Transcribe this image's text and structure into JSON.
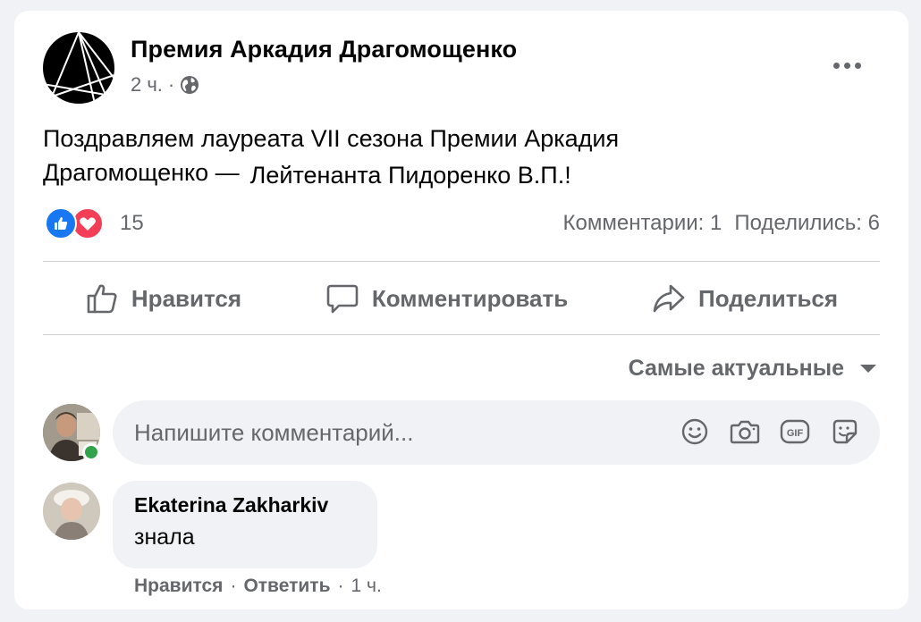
{
  "post": {
    "page_name": "Премия Аркадия Драгомощенко",
    "time": "2 ч.",
    "separator": "·",
    "privacy_icon": "globe-icon",
    "text_line1": "Поздравляем лауреата VII сезона Премии Аркадия",
    "text_line2": "Драгомощенко —",
    "text_name": "Лейтенанта Пидоренко В.П.!"
  },
  "reactions": {
    "icons": [
      "like-reaction-icon",
      "love-reaction-icon"
    ],
    "count": "15",
    "comments": "Комментарии: 1",
    "shares": "Поделились: 6"
  },
  "actions": {
    "like": "Нравится",
    "comment": "Комментировать",
    "share": "Поделиться"
  },
  "sort": {
    "label": "Самые актуальные"
  },
  "composer": {
    "placeholder": "Напишите комментарий...",
    "icons": [
      "emoji-icon",
      "camera-icon",
      "gif-icon",
      "sticker-icon"
    ]
  },
  "comments": [
    {
      "author": "Ekaterina Zakharkiv",
      "text": "знала",
      "like": "Нравится",
      "reply": "Ответить",
      "time": "1 ч."
    }
  ],
  "colors": {
    "background": "#f0f2f5",
    "card": "#ffffff",
    "secondary_text": "#65676b",
    "like_blue": "#1877f2",
    "love_red": "#f33e58",
    "online_green": "#31a24c"
  }
}
